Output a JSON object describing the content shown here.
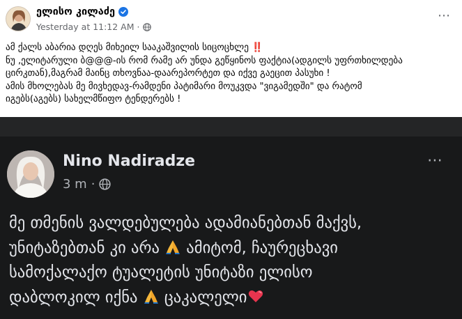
{
  "post": {
    "author": "ელისო კილაძე",
    "timestamp": "Yesterday at 11:12 AM",
    "separator": "·",
    "more_icon": "⋯",
    "text_lines": [
      "ამ ქალს აბარია დღეს მიხეილ სააკაშვილის სიცოცხლე",
      "ნუ ,ელიტარული ბ@@@-ის რომ რამე არ უნდა გეწყინოს ფაქტია(ადგილს უფრთხილდება",
      "ცირკთან),მაგრამ მაინც თხოვნაა-დაარეპორტეთ და იქვე გაეცით პასუხი !",
      "ამის მხოლებას მე მივხედავ-რამდენი პატიმარი მოუკვდა \"ვიგამედში\" და რატომ",
      "იგებს(აგებს) სახელმწიფო ტენდერებს !"
    ],
    "exclamation": "‼️"
  },
  "shared_screenshot": {
    "author": "Nino Nadiradze",
    "time": "3 m",
    "separator": "·",
    "more_icon": "⋯",
    "text_lines": [
      "მე თმენის ვალდებულება ადამიანებთან მაქვს,",
      "უნიტაზებთან კი არა",
      "ამიტომ, ჩაურეცხავი",
      "სამოქალაქო ტუალეტის უნიტაზი ელისო",
      "დაბლოკილ იქნა",
      "ცაკალელი"
    ]
  },
  "colors": {
    "verified_badge": "#1b74e4",
    "dark_background": "#18191a",
    "exclamation_red": "#e0212b",
    "heart": "#e8344e",
    "praying_hands": "#f5b73b"
  },
  "icons": [
    "verified-badge-icon",
    "globe-icon",
    "more-options-icon",
    "praying-hands-icon",
    "heart-icon"
  ]
}
